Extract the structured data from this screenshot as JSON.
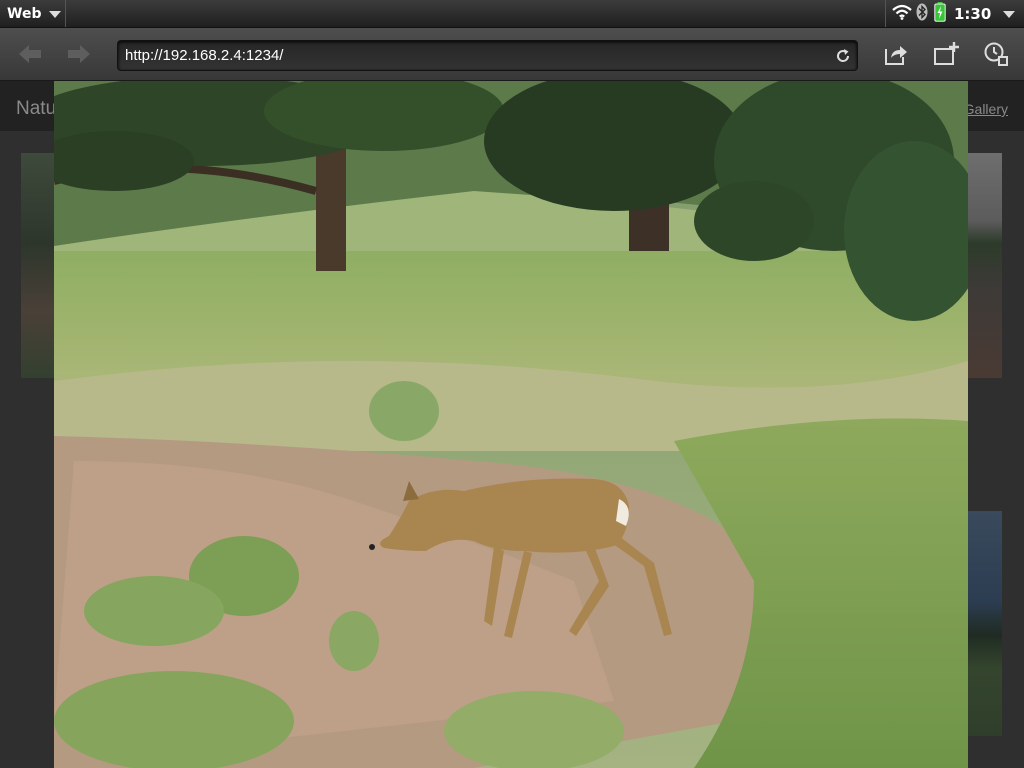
{
  "statusbar": {
    "app_name": "Web",
    "clock": "1:30",
    "icons": [
      "wifi-icon",
      "bluetooth-icon",
      "battery-charging-icon"
    ]
  },
  "toolbar": {
    "url": "http://192.168.2.4:1234/",
    "buttons": [
      "back-arrow-icon",
      "forward-arrow-icon",
      "reload-icon",
      "share-icon",
      "new-card-icon",
      "history-icon"
    ]
  },
  "page": {
    "title": "Natu",
    "gallery_link": "Gallery"
  },
  "lightbox": {
    "image_subject": "deer-in-meadow-photo"
  },
  "colors": {
    "toolbar_bg": "#444444",
    "statusbar_bg": "#2a2a2a",
    "url_text": "#ffffff",
    "battery": "#39c43a"
  }
}
